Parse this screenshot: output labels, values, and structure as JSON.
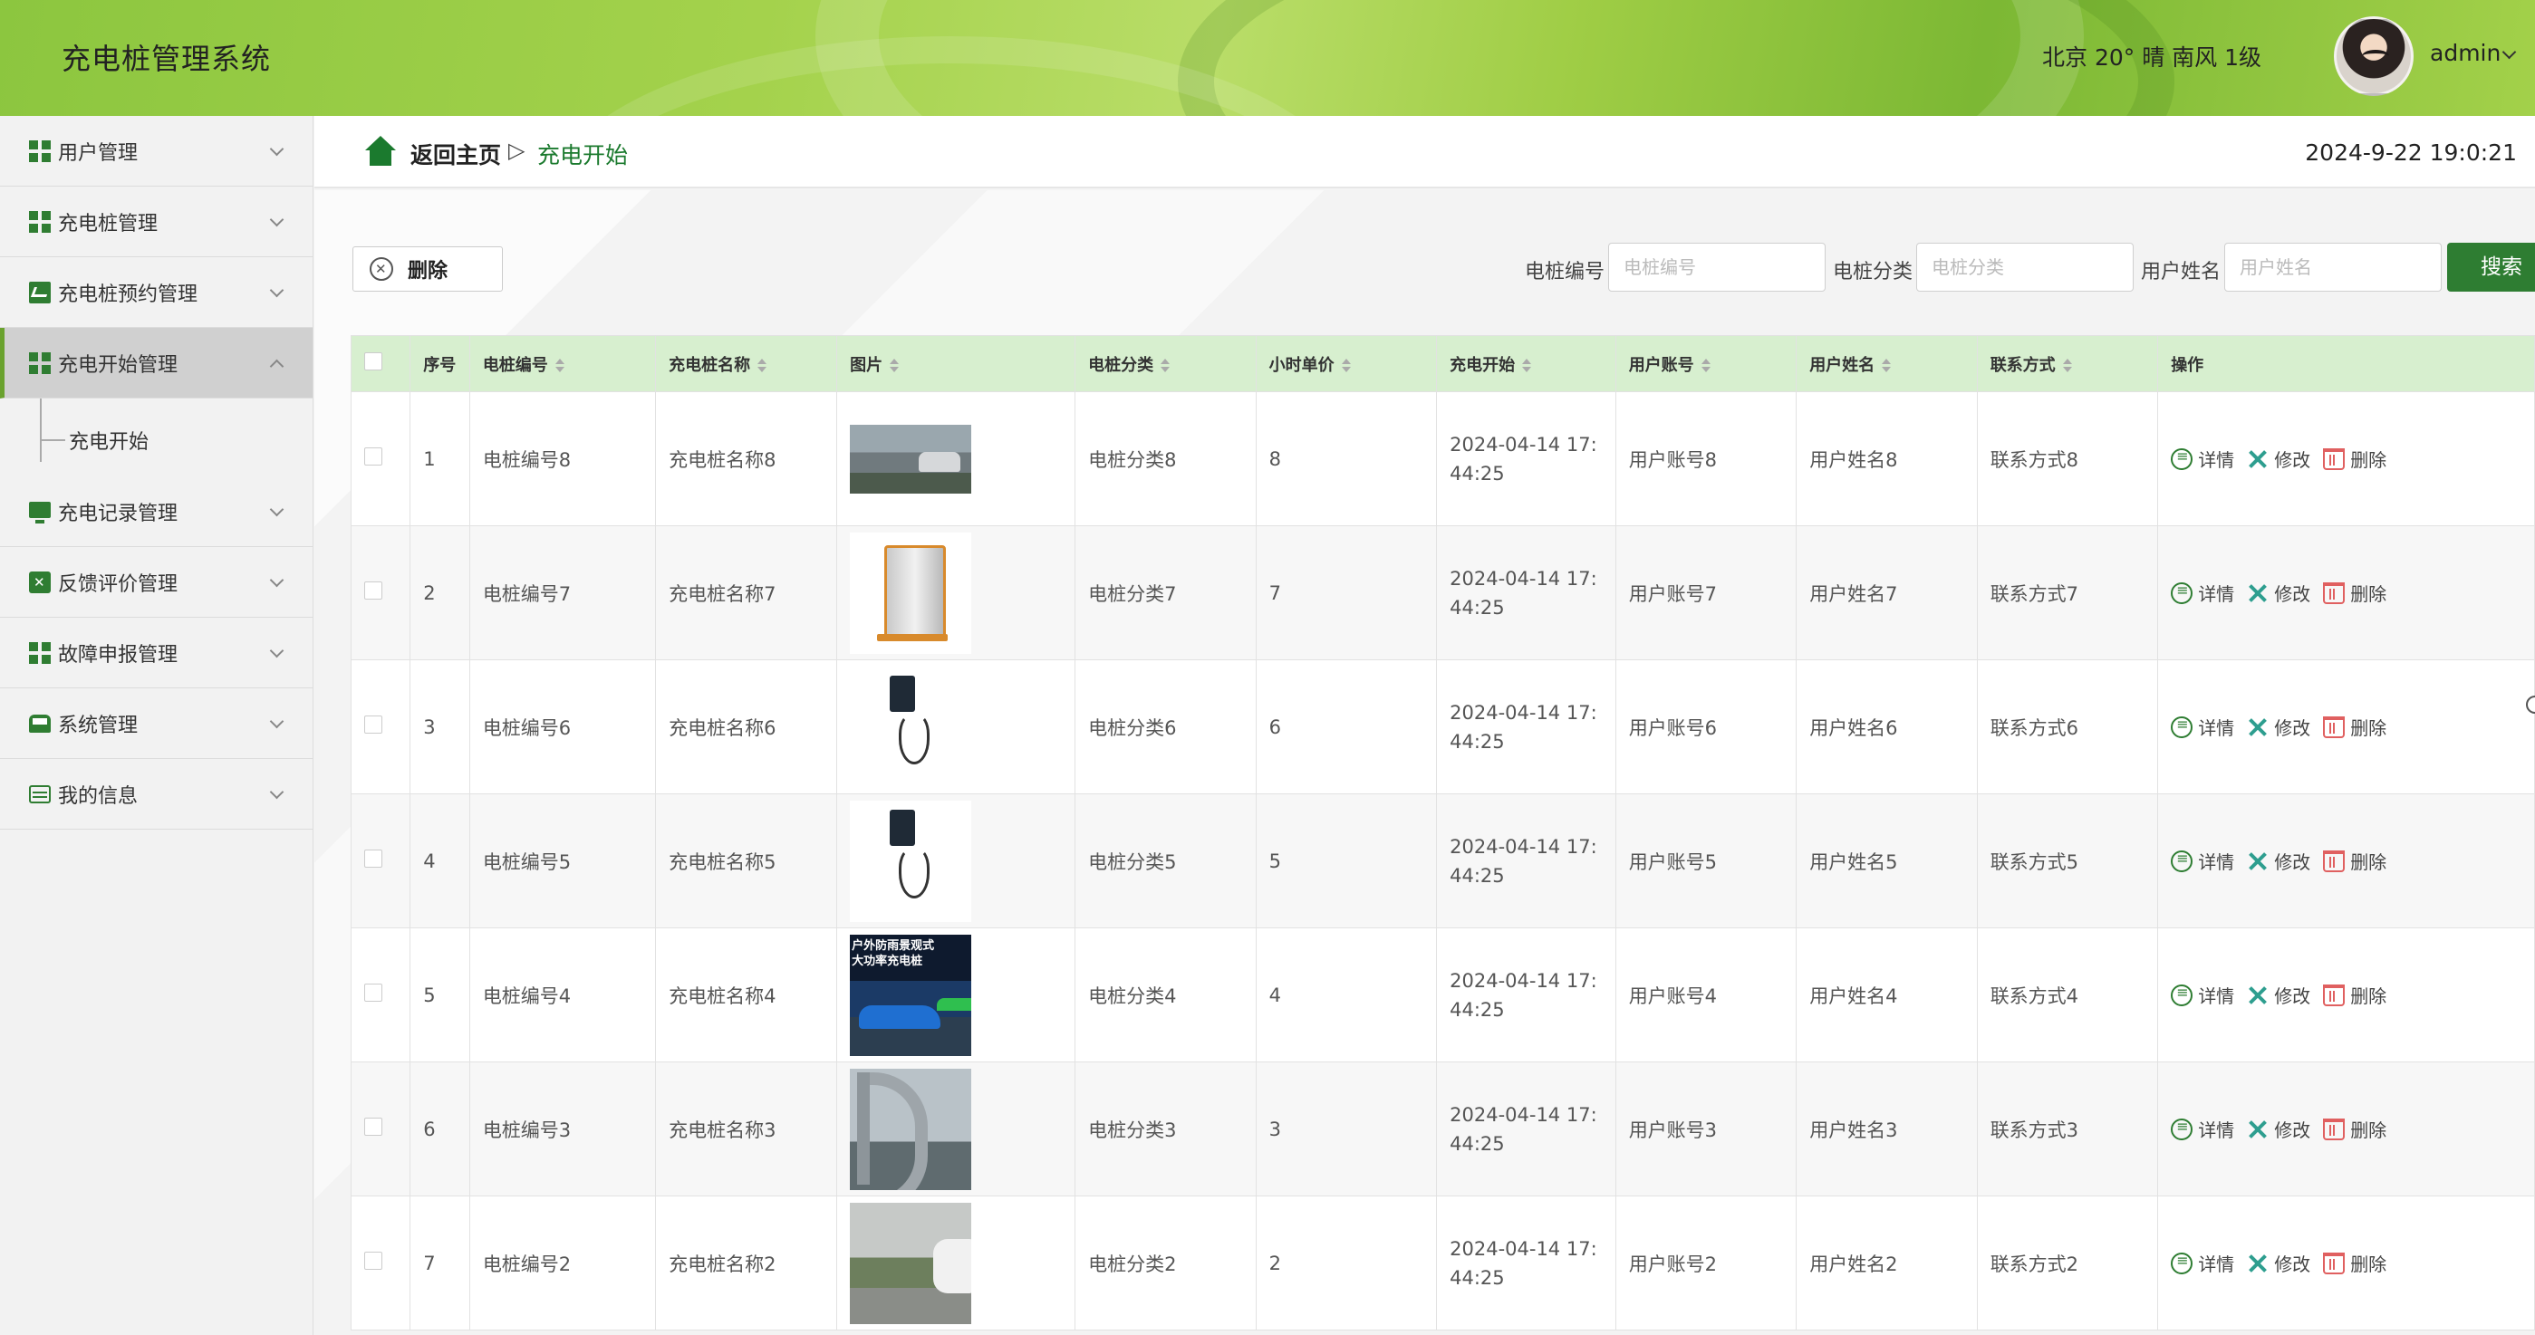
{
  "header": {
    "title": "充电桩管理系统",
    "weather": "北京  20°  晴  南风  1级",
    "user": "admin"
  },
  "sidebar": {
    "items": [
      {
        "label": "用户管理",
        "icon": "grid-icon"
      },
      {
        "label": "充电桩管理",
        "icon": "grid-icon"
      },
      {
        "label": "充电桩预约管理",
        "icon": "chart-icon"
      },
      {
        "label": "充电开始管理",
        "icon": "grid-icon",
        "active": true
      },
      {
        "label": "充电记录管理",
        "icon": "monitor-icon"
      },
      {
        "label": "反馈评价管理",
        "icon": "clipboard-icon"
      },
      {
        "label": "故障申报管理",
        "icon": "grid-icon"
      },
      {
        "label": "系统管理",
        "icon": "bus-icon"
      },
      {
        "label": "我的信息",
        "icon": "card-icon"
      }
    ],
    "submenu": "充电开始"
  },
  "breadcrumb": {
    "home": "返回主页",
    "separator": "▷",
    "current": "充电开始"
  },
  "datetime": "2024-9-22 19:0:21",
  "toolbar": {
    "delete_label": "删除",
    "search": {
      "fields": [
        {
          "label": "电桩编号",
          "placeholder": "电桩编号"
        },
        {
          "label": "电桩分类",
          "placeholder": "电桩分类"
        },
        {
          "label": "用户姓名",
          "placeholder": "用户姓名"
        }
      ],
      "button": "搜索"
    }
  },
  "table": {
    "columns": [
      "序号",
      "电桩编号",
      "充电桩名称",
      "图片",
      "电桩分类",
      "小时单价",
      "充电开始",
      "用户账号",
      "用户姓名",
      "联系方式",
      "操作"
    ],
    "actions": {
      "detail": "详情",
      "edit": "修改",
      "delete": "删除"
    },
    "rows": [
      {
        "no": "1",
        "code": "电桩编号8",
        "name": "充电桩名称8",
        "image": "street",
        "category": "电桩分类8",
        "price": "8",
        "start": "2024-04-14 17:44:25",
        "account": "用户账号8",
        "username": "用户姓名8",
        "contact": "联系方式8"
      },
      {
        "no": "2",
        "code": "电桩编号7",
        "name": "充电桩名称7",
        "image": "pillar",
        "category": "电桩分类7",
        "price": "7",
        "start": "2024-04-14 17:44:25",
        "account": "用户账号7",
        "username": "用户姓名7",
        "contact": "联系方式7"
      },
      {
        "no": "3",
        "code": "电桩编号6",
        "name": "充电桩名称6",
        "image": "wall",
        "category": "电桩分类6",
        "price": "6",
        "start": "2024-04-14 17:44:25",
        "account": "用户账号6",
        "username": "用户姓名6",
        "contact": "联系方式6"
      },
      {
        "no": "4",
        "code": "电桩编号5",
        "name": "充电桩名称5",
        "image": "wall",
        "category": "电桩分类5",
        "price": "5",
        "start": "2024-04-14 17:44:25",
        "account": "用户账号5",
        "username": "用户姓名5",
        "contact": "联系方式5"
      },
      {
        "no": "5",
        "code": "电桩编号4",
        "name": "充电桩名称4",
        "image": "ad",
        "category": "电桩分类4",
        "price": "4",
        "start": "2024-04-14 17:44:25",
        "account": "用户账号4",
        "username": "用户姓名4",
        "contact": "联系方式4"
      },
      {
        "no": "6",
        "code": "电桩编号3",
        "name": "充电桩名称3",
        "image": "d",
        "category": "电桩分类3",
        "price": "3",
        "start": "2024-04-14 17:44:25",
        "account": "用户账号3",
        "username": "用户姓名3",
        "contact": "联系方式3"
      },
      {
        "no": "7",
        "code": "电桩编号2",
        "name": "充电桩名称2",
        "image": "yard",
        "category": "电桩分类2",
        "price": "2",
        "start": "2024-04-14 17:44:25",
        "account": "用户账号2",
        "username": "用户姓名2",
        "contact": "联系方式2"
      }
    ]
  },
  "colors": {
    "accent": "#2e7d32",
    "header": "#8cc63f",
    "table_header": "#d7efcf"
  }
}
